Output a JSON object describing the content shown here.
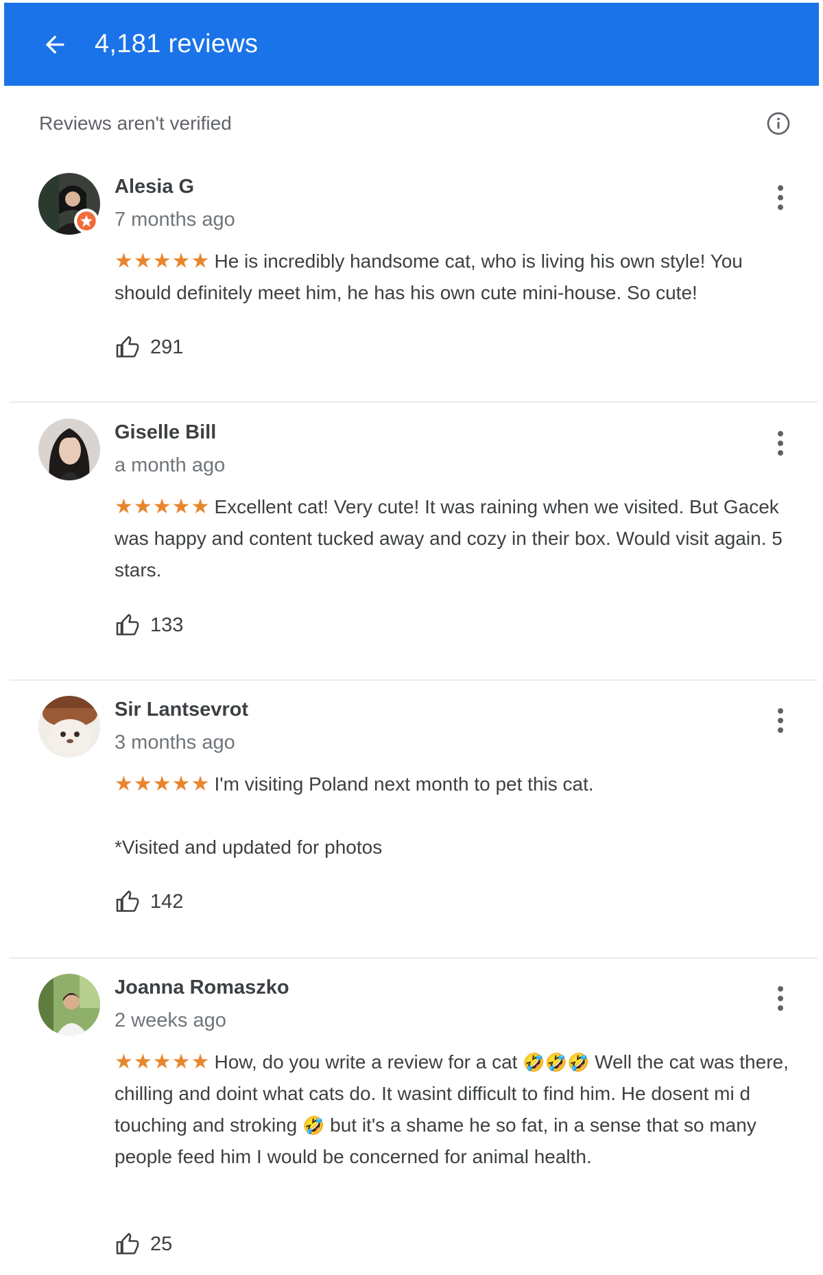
{
  "header": {
    "back_icon": "arrow-back-icon",
    "title": "4,181 reviews",
    "color": "#1a73e8"
  },
  "notice": {
    "text": "Reviews aren't verified",
    "icon": "info-icon"
  },
  "star_color": "#e8862d",
  "reviews": [
    {
      "author": "Alesia G",
      "date": "7 months ago",
      "rating": 5,
      "stars": "★★★★★",
      "text": "He is incredibly handsome cat, who is living his own style! You should definitely meet him, he has his own cute mini-house. So cute!",
      "likes": "291",
      "local_guide_badge": true
    },
    {
      "author": "Giselle Bill",
      "date": "a month ago",
      "rating": 5,
      "stars": "★★★★★",
      "text": "Excellent cat! Very cute! It was raining when we visited. But Gacek was happy and content tucked away and cozy in their box. Would visit again. 5 stars.",
      "likes": "133"
    },
    {
      "author": "Sir Lantsevrot",
      "date": "3 months ago",
      "rating": 5,
      "stars": "★★★★★",
      "text": "I'm visiting Poland next month to pet this cat.",
      "extra": "*Visited and updated for photos",
      "likes": "142"
    },
    {
      "author": "Joanna Romaszko",
      "date": "2 weeks ago",
      "rating": 5,
      "stars": "★★★★★",
      "text_part1": "How, do you write a review for a cat",
      "emoji_laugh": "🤣",
      "text_part2": "Well the cat was there, chilling and doint what cats do. It wasint difficult to find him. He dosent mi d touching and stroking",
      "text_part3": "but it's a shame he so fat, in a sense that so many people feed him I would be concerned for animal health.",
      "likes": "25"
    }
  ]
}
